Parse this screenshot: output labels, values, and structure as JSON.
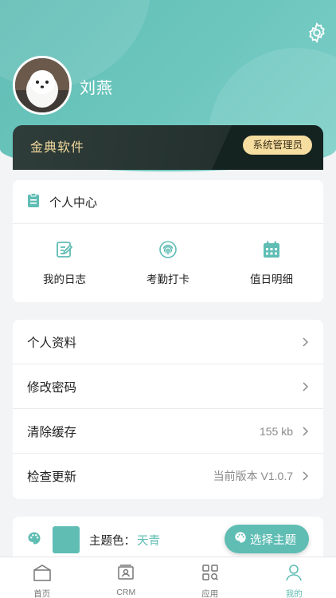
{
  "profile": {
    "name": "刘燕"
  },
  "company": {
    "name": "金典软件",
    "role": "系统管理员"
  },
  "personal_center": {
    "title": "个人中心",
    "items": [
      {
        "label": "我的日志",
        "icon": "edit-note-icon"
      },
      {
        "label": "考勤打卡",
        "icon": "fingerprint-icon"
      },
      {
        "label": "值日明细",
        "icon": "calendar-icon"
      }
    ]
  },
  "menu": {
    "profile": {
      "label": "个人资料"
    },
    "password": {
      "label": "修改密码"
    },
    "cache": {
      "label": "清除缓存",
      "value": "155 kb"
    },
    "update": {
      "label": "检查更新",
      "value": "当前版本 V1.0.7"
    }
  },
  "theme": {
    "label": "主题色：",
    "value": "天青",
    "button": "选择主题",
    "color": "#5fbdb4"
  },
  "tabs": [
    {
      "label": "首页",
      "icon": "home-icon"
    },
    {
      "label": "CRM",
      "icon": "crm-icon"
    },
    {
      "label": "应用",
      "icon": "apps-icon"
    },
    {
      "label": "我的",
      "icon": "user-icon",
      "active": true
    }
  ],
  "colors": {
    "accent": "#5fbdb4",
    "badge": "#f6dda0",
    "dark_card": "#1e2a28"
  }
}
